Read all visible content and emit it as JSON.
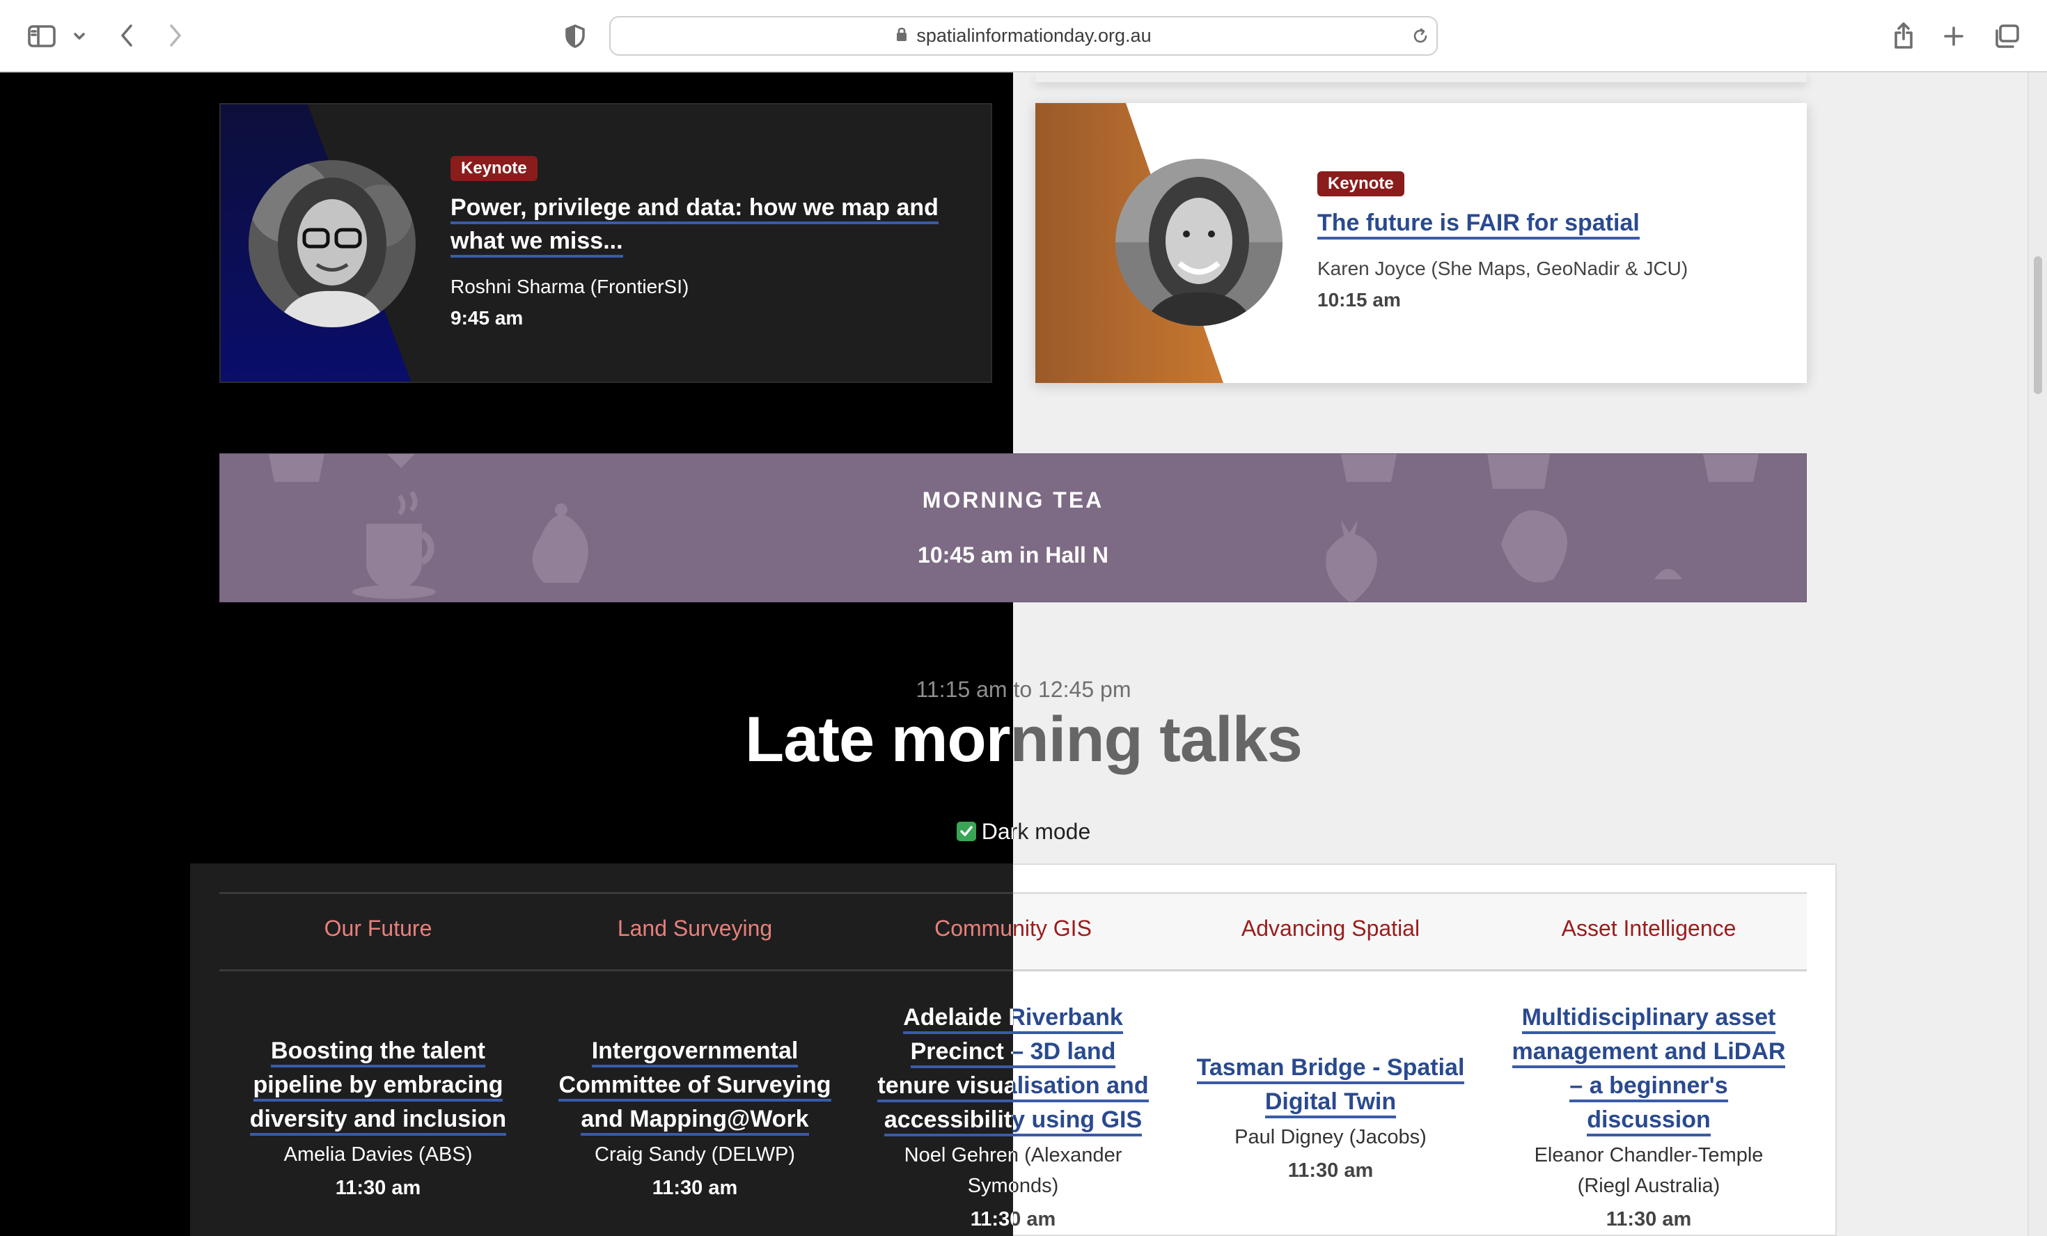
{
  "browser": {
    "url": "spatialinformationday.org.au",
    "icons": [
      "sidebar-icon",
      "chevron-down-icon",
      "back-icon",
      "forward-icon",
      "privacy-shield-icon",
      "lock-icon",
      "reload-icon",
      "share-icon",
      "new-tab-icon",
      "tab-overview-icon"
    ]
  },
  "keynotes": [
    {
      "tag": "Keynote",
      "title_line1": "Power, privilege and data: how we map and",
      "title_line2": "what we miss...",
      "speaker": "Roshni Sharma (FrontierSI)",
      "time": "9:45 am"
    },
    {
      "tag": "Keynote",
      "title": "The future is FAIR for spatial",
      "speaker": "Karen Joyce (She Maps, GeoNadir & JCU)",
      "time": "10:15 am"
    }
  ],
  "morning_tea": {
    "title": "MORNING TEA",
    "time": "10:45 am in Hall N"
  },
  "section": {
    "period": "11:15 am to 12:45 pm",
    "title": "Late morning talks",
    "dark_mode_label": "Dark mode",
    "dark_mode_checked": true
  },
  "schedule": {
    "columns": [
      "Our Future",
      "Land Surveying",
      "Community GIS",
      "Advancing Spatial",
      "Asset Intelligence"
    ],
    "talks": [
      {
        "title_lines": [
          "Boosting the talent",
          "pipeline by embracing",
          "diversity and inclusion"
        ],
        "speaker_lines": [
          "Amelia Davies (ABS)"
        ],
        "time": "11:30 am"
      },
      {
        "title_lines": [
          "Intergovernmental",
          "Committee of Surveying",
          "and Mapping@Work"
        ],
        "speaker_lines": [
          "Craig Sandy (DELWP)"
        ],
        "time": "11:30 am"
      },
      {
        "title_lines": [
          "Adelaide Riverbank",
          "Precinct – 3D land",
          "tenure visualisation and",
          "accessibility using GIS"
        ],
        "speaker_lines": [
          "Noel Gehren (Alexander",
          "Symonds)"
        ],
        "time": "11:30 am"
      },
      {
        "title_lines": [
          "Tasman Bridge - Spatial",
          "Digital Twin"
        ],
        "speaker_lines": [
          "Paul Digney (Jacobs)"
        ],
        "time": "11:30 am"
      },
      {
        "title_lines": [
          "Multidisciplinary asset",
          "management and LiDAR",
          "– a beginner's",
          "discussion"
        ],
        "speaker_lines": [
          "Eleanor Chandler-Temple",
          "(Riegl Australia)"
        ],
        "time": "11:30 am"
      }
    ]
  },
  "colors": {
    "dark_bg": "#000000",
    "light_bg": "#efefef",
    "keynote_tag": "#8a1c1c",
    "link_blue": "#2a4a8f",
    "tea_purple": "#7d6a84",
    "track_head_dark": "#e8807c",
    "track_head_light": "#9a1c1c",
    "checkbox_green": "#3aa555"
  }
}
